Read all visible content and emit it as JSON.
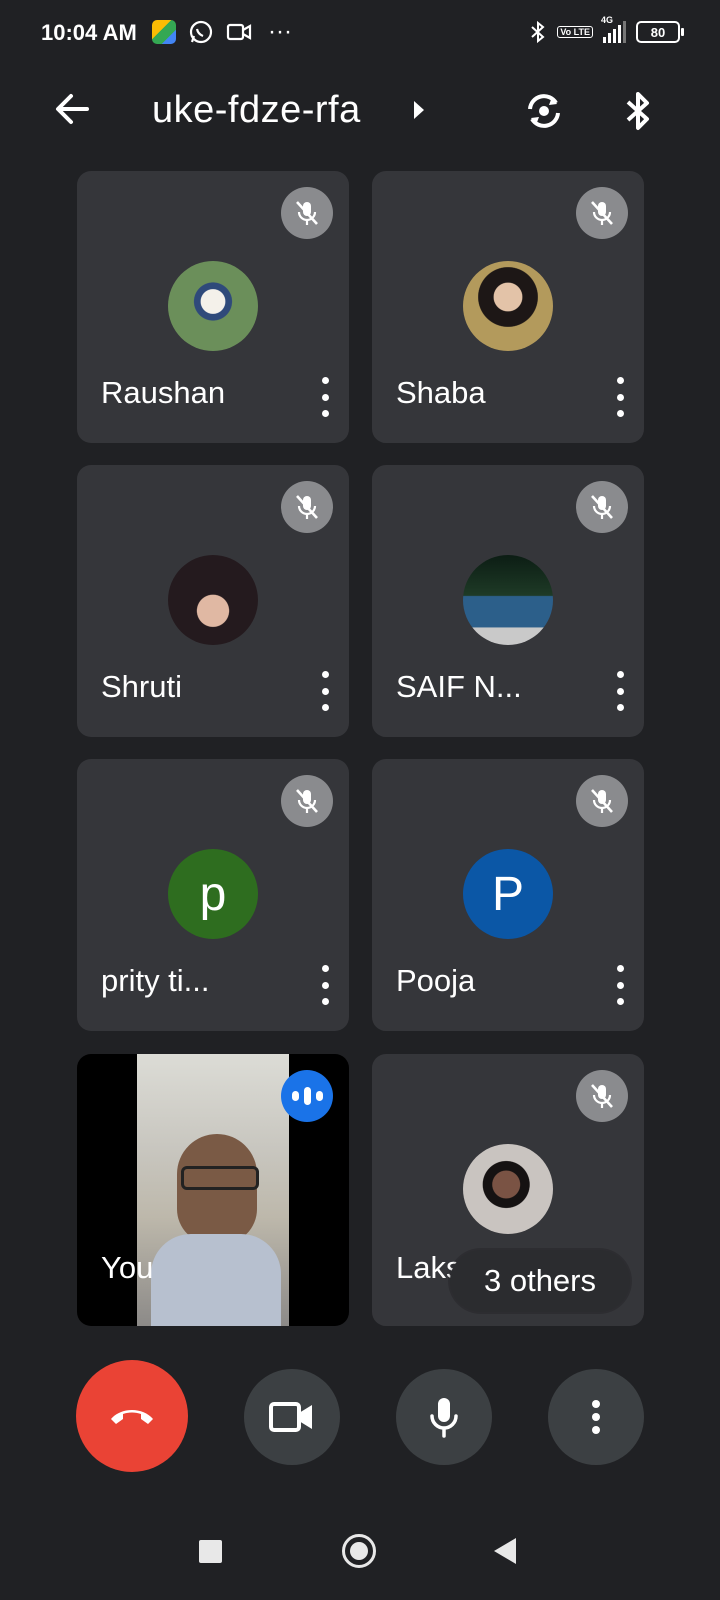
{
  "status_bar": {
    "time": "10:04 AM",
    "dots": "···",
    "battery": "80",
    "network": "4G",
    "volte_label": "Vo LTE"
  },
  "header": {
    "meeting_code": "uke-fdze-rfa"
  },
  "participants": [
    {
      "name": "Raushan",
      "avatar_type": "photo",
      "avatar_color": "#6b8f5a",
      "muted": true
    },
    {
      "name": "Shaba",
      "avatar_type": "photo",
      "avatar_color": "#b39a5c",
      "muted": true
    },
    {
      "name": "Shruti",
      "avatar_type": "photo",
      "avatar_color": "#3a2a30",
      "muted": true
    },
    {
      "name": "SAIF N...",
      "avatar_type": "photo",
      "avatar_color": "#2c5f8a",
      "muted": true
    },
    {
      "name": "prity ti...",
      "avatar_type": "initial",
      "initial": "p",
      "avatar_color": "#2e6d1f",
      "muted": true
    },
    {
      "name": "Pooja",
      "avatar_type": "initial",
      "initial": "P",
      "avatar_color": "#0b57a6",
      "muted": true
    },
    {
      "name": "You",
      "avatar_type": "video",
      "speaking": true
    },
    {
      "name": "Laks",
      "avatar_type": "photo",
      "avatar_color": "#c9c4c0",
      "muted": true
    }
  ],
  "others_label": "3 others",
  "colors": {
    "end_call": "#ea4335",
    "speaking_badge": "#1a73e8",
    "tile_bg": "#35363a",
    "background": "#202124"
  }
}
